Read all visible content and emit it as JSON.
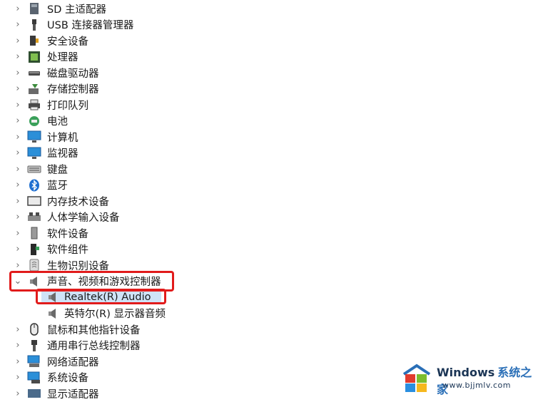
{
  "tree": {
    "items": [
      {
        "label": "SD 主适配器",
        "icon": "sd-card-icon",
        "expanded": false
      },
      {
        "label": "USB 连接器管理器",
        "icon": "usb-icon",
        "expanded": false
      },
      {
        "label": "安全设备",
        "icon": "security-key-icon",
        "expanded": false
      },
      {
        "label": "处理器",
        "icon": "processor-icon",
        "expanded": false
      },
      {
        "label": "磁盘驱动器",
        "icon": "disk-drive-icon",
        "expanded": false
      },
      {
        "label": "存储控制器",
        "icon": "storage-controller-icon",
        "expanded": false
      },
      {
        "label": "打印队列",
        "icon": "printer-icon",
        "expanded": false
      },
      {
        "label": "电池",
        "icon": "battery-icon",
        "expanded": false
      },
      {
        "label": "计算机",
        "icon": "computer-icon",
        "expanded": false
      },
      {
        "label": "监视器",
        "icon": "monitor-icon",
        "expanded": false
      },
      {
        "label": "键盘",
        "icon": "keyboard-icon",
        "expanded": false
      },
      {
        "label": "蓝牙",
        "icon": "bluetooth-icon",
        "expanded": false
      },
      {
        "label": "内存技术设备",
        "icon": "memory-device-icon",
        "expanded": false
      },
      {
        "label": "人体学输入设备",
        "icon": "hid-icon",
        "expanded": false
      },
      {
        "label": "软件设备",
        "icon": "software-device-icon",
        "expanded": false
      },
      {
        "label": "软件组件",
        "icon": "software-component-icon",
        "expanded": false
      },
      {
        "label": "生物识别设备",
        "icon": "fingerprint-icon",
        "expanded": false
      },
      {
        "label": "声音、视频和游戏控制器",
        "icon": "speaker-icon",
        "expanded": true,
        "children": [
          {
            "label": "Realtek(R) Audio",
            "icon": "speaker-icon",
            "selected": true
          },
          {
            "label": "英特尔(R) 显示器音频",
            "icon": "speaker-icon",
            "selected": false
          }
        ]
      },
      {
        "label": "鼠标和其他指针设备",
        "icon": "mouse-icon",
        "expanded": false
      },
      {
        "label": "通用串行总线控制器",
        "icon": "usb-controller-icon",
        "expanded": false
      },
      {
        "label": "网络适配器",
        "icon": "network-adapter-icon",
        "expanded": false
      },
      {
        "label": "系统设备",
        "icon": "system-device-icon",
        "expanded": false
      },
      {
        "label": "显示适配器",
        "icon": "display-adapter-icon",
        "expanded": false
      }
    ]
  },
  "watermark": {
    "title": "Windows",
    "title_cn": "系统之家",
    "url": "www.bjjmlv.com"
  },
  "colors": {
    "highlight": "#e11b1b",
    "selection": "#cfe3f7",
    "windows_blue": "#2a6fb7"
  }
}
